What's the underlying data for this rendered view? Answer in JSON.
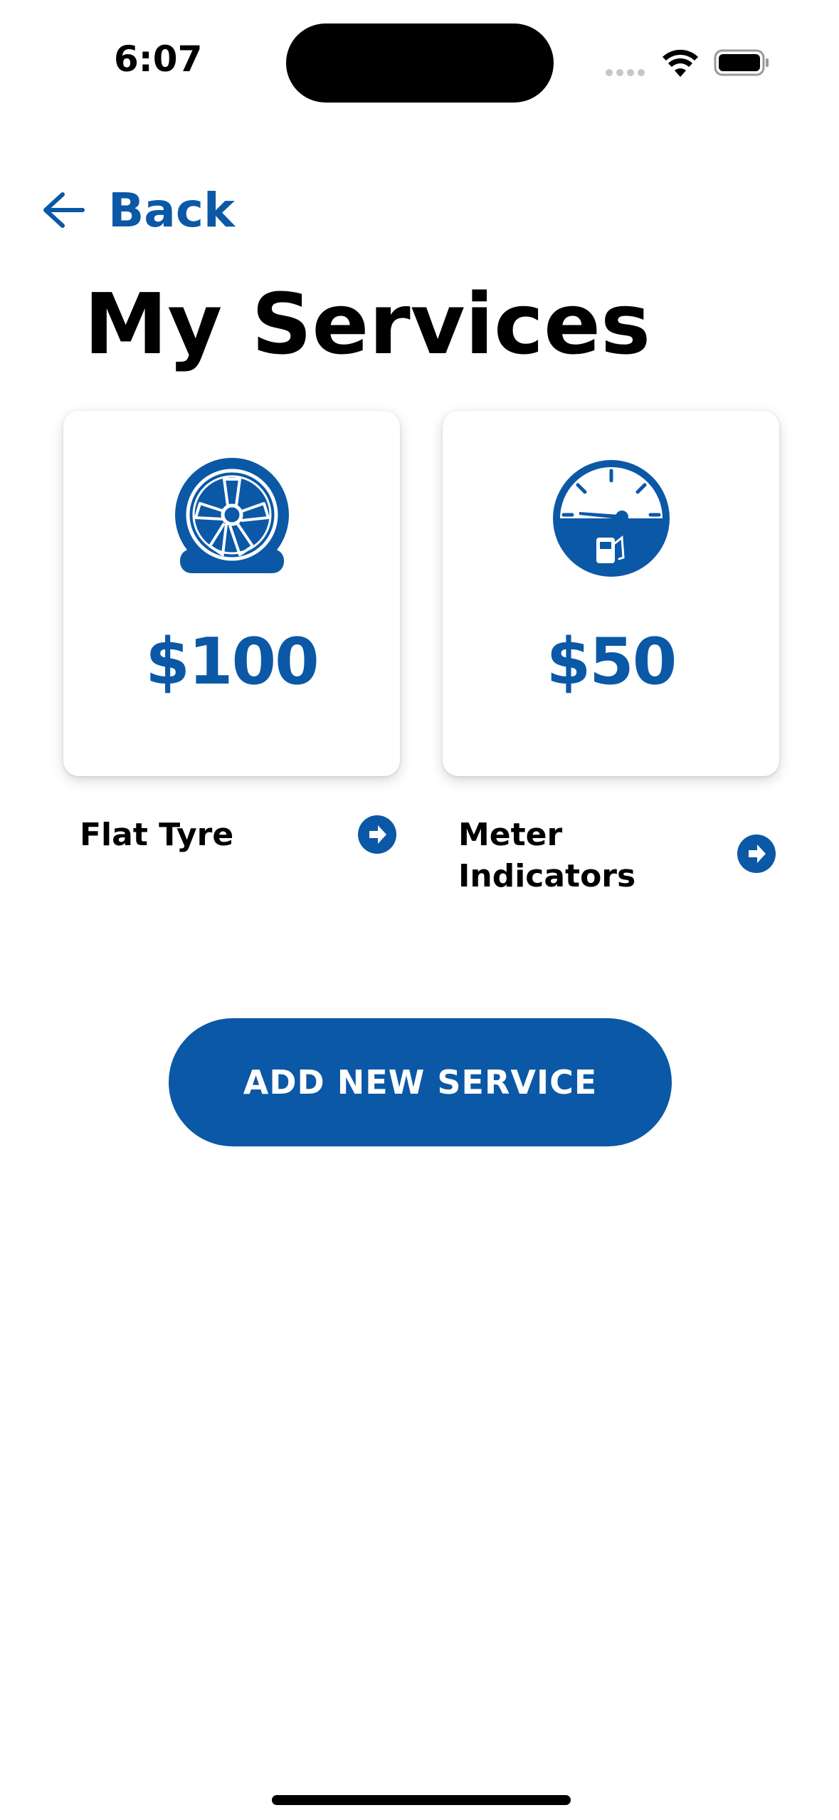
{
  "status_bar": {
    "time": "6:07"
  },
  "nav": {
    "back_label": "Back"
  },
  "page": {
    "title": "My Services"
  },
  "services": [
    {
      "name": "Flat Tyre",
      "price": "$100",
      "icon": "flat-tyre-icon"
    },
    {
      "name": "Meter Indicators",
      "price": "$50",
      "icon": "fuel-gauge-icon"
    }
  ],
  "actions": {
    "add_service_label": "ADD NEW SERVICE"
  },
  "colors": {
    "accent": "#0a58a6",
    "background": "#ffffff",
    "text": "#000000"
  }
}
